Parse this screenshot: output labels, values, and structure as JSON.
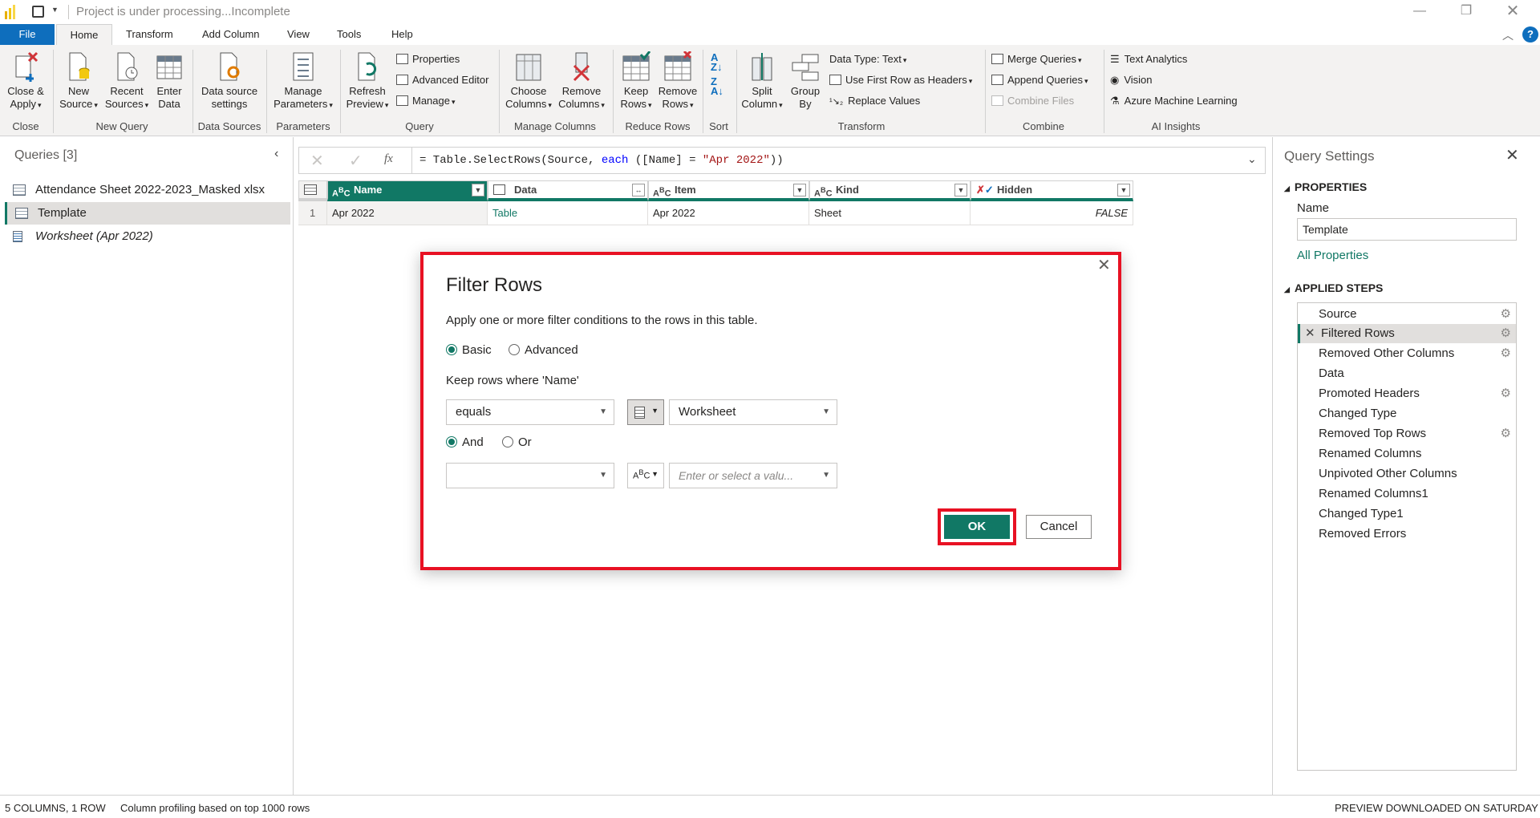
{
  "window": {
    "title": "Project is under processing...Incomplete"
  },
  "menu_tabs": [
    "File",
    "Home",
    "Transform",
    "Add Column",
    "View",
    "Tools",
    "Help"
  ],
  "ribbon": {
    "close": {
      "close_apply": [
        "Close &",
        "Apply"
      ],
      "group": "Close"
    },
    "new_query": {
      "new_source": [
        "New",
        "Source"
      ],
      "recent_sources": [
        "Recent",
        "Sources"
      ],
      "enter_data": [
        "Enter",
        "Data"
      ],
      "group": "New Query"
    },
    "data_sources": {
      "settings": [
        "Data source",
        "settings"
      ],
      "group": "Data Sources"
    },
    "parameters": {
      "manage": [
        "Manage",
        "Parameters"
      ],
      "group": "Parameters"
    },
    "query": {
      "refresh": [
        "Refresh",
        "Preview"
      ],
      "properties": "Properties",
      "advanced_editor": "Advanced Editor",
      "manage": "Manage",
      "group": "Query"
    },
    "manage_columns": {
      "choose": [
        "Choose",
        "Columns"
      ],
      "remove": [
        "Remove",
        "Columns"
      ],
      "group": "Manage Columns"
    },
    "reduce_rows": {
      "keep": [
        "Keep",
        "Rows"
      ],
      "remove": [
        "Remove",
        "Rows"
      ],
      "group": "Reduce Rows"
    },
    "sort": {
      "group": "Sort"
    },
    "transform": {
      "split": [
        "Split",
        "Column"
      ],
      "group_by": [
        "Group",
        "By"
      ],
      "data_type": "Data Type: Text",
      "first_row": "Use First Row as Headers",
      "replace": "Replace Values",
      "group": "Transform"
    },
    "combine": {
      "merge": "Merge Queries",
      "append": "Append Queries",
      "combine_files": "Combine Files",
      "group": "Combine"
    },
    "ai": {
      "text_analytics": "Text Analytics",
      "vision": "Vision",
      "azure_ml": "Azure Machine Learning",
      "group": "AI Insights"
    }
  },
  "queries_pane": {
    "title": "Queries [3]",
    "items": [
      {
        "label": "Attendance Sheet 2022-2023_Masked xlsx"
      },
      {
        "label": "Template"
      },
      {
        "label": "Worksheet (Apr 2022)"
      }
    ]
  },
  "formula": "= Table.SelectRows(Source, each ([Name] = \"Apr 2022\"))",
  "formula_parts": {
    "a": "= Table.SelectRows(Source, ",
    "kw": "each",
    "b": " ([Name] = ",
    "str": "\"Apr 2022\"",
    "c": "))"
  },
  "grid": {
    "columns": [
      "Name",
      "Data",
      "Item",
      "Kind",
      "Hidden"
    ],
    "row_number": "1",
    "row": [
      "Apr 2022",
      "Table",
      "Apr 2022",
      "Sheet",
      "FALSE"
    ]
  },
  "dialog": {
    "title": "Filter Rows",
    "description": "Apply one or more filter conditions to the rows in this table.",
    "mode_basic": "Basic",
    "mode_advanced": "Advanced",
    "keep_label": "Keep rows where 'Name'",
    "operator1": "equals",
    "value1": "Worksheet",
    "logic_and": "And",
    "logic_or": "Or",
    "operator2": "",
    "value2_placeholder": "Enter or select a valu...",
    "ok": "OK",
    "cancel": "Cancel"
  },
  "settings_pane": {
    "title": "Query Settings",
    "properties_header": "PROPERTIES",
    "name_label": "Name",
    "name_value": "Template",
    "all_properties": "All Properties",
    "steps_header": "APPLIED STEPS",
    "steps": [
      {
        "label": "Source",
        "gear": true
      },
      {
        "label": "Filtered Rows",
        "gear": true
      },
      {
        "label": "Removed Other Columns",
        "gear": true
      },
      {
        "label": "Data",
        "gear": false
      },
      {
        "label": "Promoted Headers",
        "gear": true
      },
      {
        "label": "Changed Type",
        "gear": false
      },
      {
        "label": "Removed Top Rows",
        "gear": true
      },
      {
        "label": "Renamed Columns",
        "gear": false
      },
      {
        "label": "Unpivoted Other Columns",
        "gear": false
      },
      {
        "label": "Renamed Columns1",
        "gear": false
      },
      {
        "label": "Changed Type1",
        "gear": false
      },
      {
        "label": "Removed Errors",
        "gear": false
      }
    ]
  },
  "status": {
    "left": "5 COLUMNS, 1 ROW",
    "profiling": "Column profiling based on top 1000 rows",
    "right": "PREVIEW DOWNLOADED ON SATURDAY"
  },
  "colors": {
    "accent": "#117865",
    "file_tab": "#0e6ebd",
    "highlight_border": "#e81123"
  }
}
